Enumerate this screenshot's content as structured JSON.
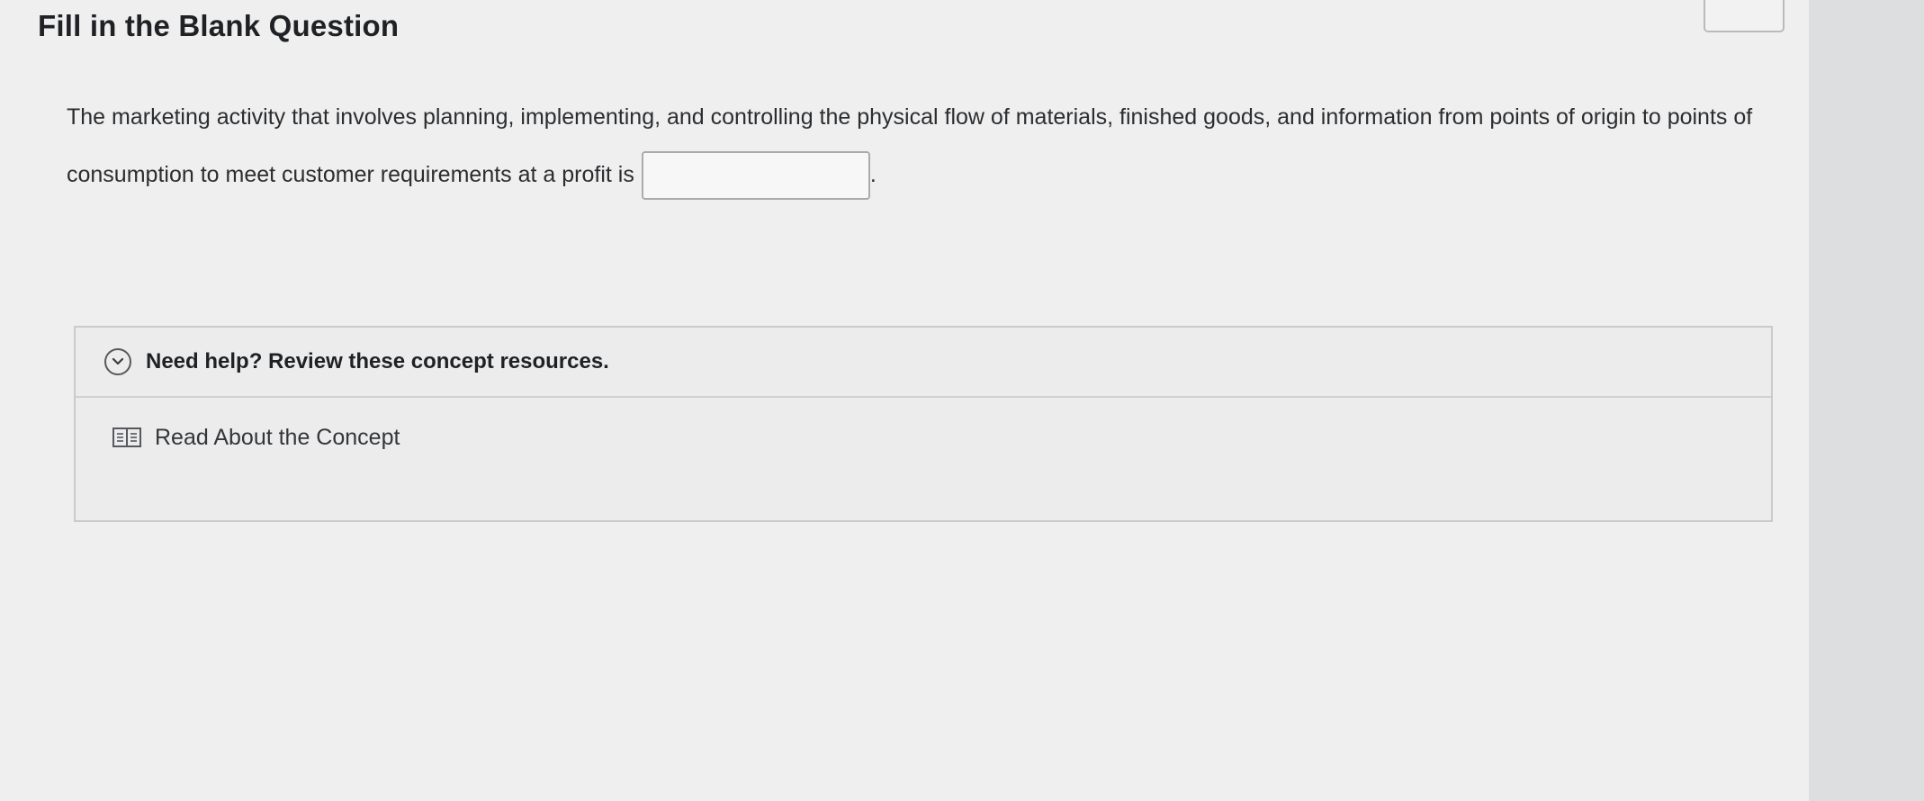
{
  "header": {
    "title": "Fill in the Blank Question"
  },
  "question": {
    "text": "The marketing activity that involves planning, implementing, and controlling the physical flow of materials, finished goods, and information from points of origin to points of consumption to meet customer requirements at a profit is",
    "blank_value": "",
    "trailing": "."
  },
  "help": {
    "title": "Need help? Review these concept resources.",
    "expand_icon": "chevron-down-circle-icon",
    "resources": [
      {
        "label": "Read About the Concept",
        "icon": "book-icon"
      }
    ]
  },
  "colors": {
    "page_background": "#efefef",
    "text": "#2b2d30",
    "border": "#c9cacc"
  }
}
